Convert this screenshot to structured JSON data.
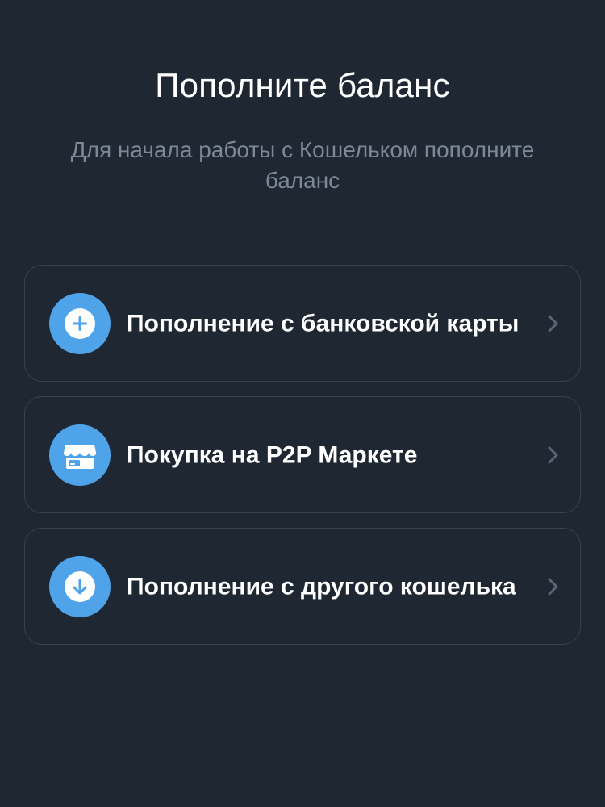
{
  "header": {
    "title": "Пополните баланс",
    "subtitle": "Для начала работы с Кошельком пополните баланс"
  },
  "options": [
    {
      "label": "Пополнение с банковской карты",
      "icon": "plus-circle-icon"
    },
    {
      "label": "Покупка на P2P Маркете",
      "icon": "store-icon"
    },
    {
      "label": "Пополнение с другого кошелька",
      "icon": "arrow-down-circle-icon"
    }
  ],
  "colors": {
    "background": "#1f2733",
    "card_border": "#39424f",
    "accent": "#4fa3e8",
    "subtitle": "#7d8896",
    "chevron": "#5a6472"
  }
}
